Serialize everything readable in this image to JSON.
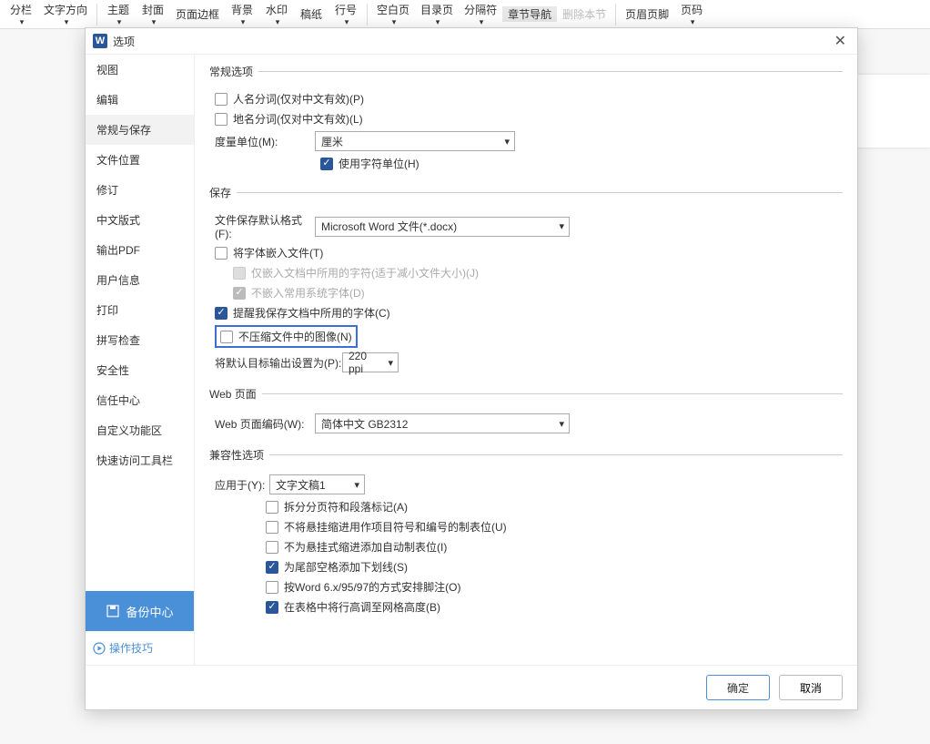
{
  "ribbon": {
    "items": [
      {
        "label": "分栏",
        "dd": true
      },
      {
        "label": "文字方向",
        "dd": true
      },
      {
        "sep": true
      },
      {
        "label": "主题",
        "dd": true
      },
      {
        "label": "封面",
        "dd": true
      },
      {
        "label": "页面边框"
      },
      {
        "label": "背景",
        "dd": true
      },
      {
        "label": "水印",
        "dd": true
      },
      {
        "label": "稿纸"
      },
      {
        "label": "行号",
        "dd": true
      },
      {
        "sep": true
      },
      {
        "label": "空白页",
        "dd": true
      },
      {
        "label": "目录页",
        "dd": true
      },
      {
        "label": "分隔符",
        "dd": true
      },
      {
        "label": "章节导航",
        "active": true
      },
      {
        "label": "删除本节",
        "disabled": true
      },
      {
        "sep": true
      },
      {
        "label": "页眉页脚"
      },
      {
        "label": "页码",
        "dd": true
      }
    ]
  },
  "dialog": {
    "title": "选项",
    "sidebar": {
      "items": [
        "视图",
        "编辑",
        "常规与保存",
        "文件位置",
        "修订",
        "中文版式",
        "输出PDF",
        "用户信息",
        "打印",
        "拼写检查",
        "安全性",
        "信任中心",
        "自定义功能区",
        "快速访问工具栏"
      ],
      "activeIndex": 2,
      "backup": "备份中心",
      "tip": "操作技巧"
    },
    "footer": {
      "ok": "确定",
      "cancel": "取消"
    }
  },
  "section_general": {
    "legend": "常规选项",
    "name_seg": "人名分词(仅对中文有效)(P)",
    "place_seg": "地名分词(仅对中文有效)(L)",
    "unit_label": "度量单位(M):",
    "unit_value": "厘米",
    "use_char_unit": "使用字符单位(H)"
  },
  "section_save": {
    "legend": "保存",
    "format_label": "文件保存默认格式(F):",
    "format_value": "Microsoft Word 文件(*.docx)",
    "embed_fonts": "将字体嵌入文件(T)",
    "embed_used": "仅嵌入文档中所用的字符(适于减小文件大小)(J)",
    "no_sys_fonts": "不嵌入常用系统字体(D)",
    "remind_fonts": "提醒我保存文档中所用的字体(C)",
    "no_compress_img": "不压缩文件中的图像(N)",
    "default_out_label": "将默认目标输出设置为(P):",
    "default_out_value": "220 ppi"
  },
  "section_web": {
    "legend": "Web 页面",
    "encoding_label": "Web 页面编码(W):",
    "encoding_value": "简体中文 GB2312"
  },
  "section_compat": {
    "legend": "兼容性选项",
    "apply_label": "应用于(Y):",
    "apply_value": "文字文稿1",
    "split_page": "拆分分页符和段落标记(A)",
    "no_hang_indent": "不将悬挂缩进用作项目符号和编号的制表位(U)",
    "no_auto_tab": "不为悬挂式缩进添加自动制表位(I)",
    "underline_trail": "为尾部空格添加下划线(S)",
    "word6_footnote": "按Word 6.x/95/97的方式安排脚注(O)",
    "table_grid_height": "在表格中将行高调至网格高度(B)"
  }
}
